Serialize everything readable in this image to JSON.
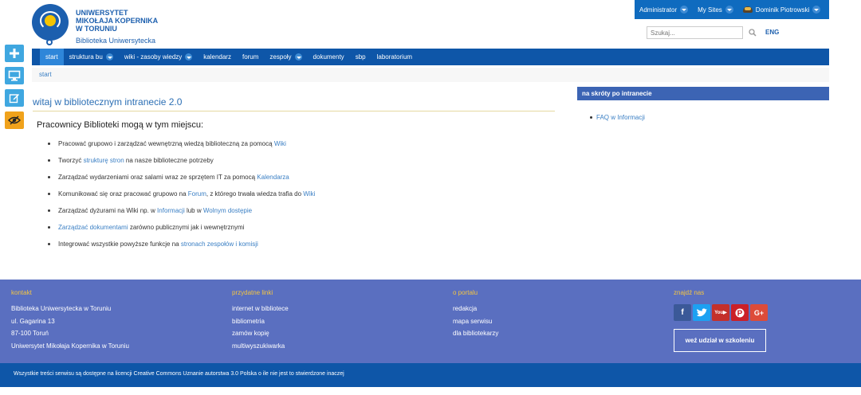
{
  "header": {
    "university": "UNIWERSYTET\nMIKOŁAJA KOPERNIKA\nW TORUNIU",
    "library": "Biblioteka Uniwersytecka",
    "user_menu": [
      "Administrator",
      "My Sites",
      "Dominik Piotrowski"
    ],
    "search_placeholder": "Szukaj...",
    "lang": "ENG"
  },
  "nav": {
    "items": [
      {
        "label": "start",
        "dropdown": false
      },
      {
        "label": "struktura bu",
        "dropdown": true
      },
      {
        "label": "wiki - zasoby wiedzy",
        "dropdown": true
      },
      {
        "label": "kalendarz",
        "dropdown": false
      },
      {
        "label": "forum",
        "dropdown": false
      },
      {
        "label": "zespoły",
        "dropdown": true
      },
      {
        "label": "dokumenty",
        "dropdown": false
      },
      {
        "label": "sbp",
        "dropdown": false
      },
      {
        "label": "laboratorium",
        "dropdown": false
      }
    ]
  },
  "breadcrumb": "start",
  "main": {
    "title": "witaj w bibliotecznym intranecie 2.0",
    "intro": "Pracownicy Biblioteki mogą w tym miejscu:",
    "items": [
      [
        {
          "t": "Pracować grupowo i zarządzać wewnętrzną wiedzą biblioteczną za pomocą "
        },
        {
          "t": "Wiki",
          "link": true
        }
      ],
      [
        {
          "t": "Tworzyć "
        },
        {
          "t": "strukturę stron",
          "link": true
        },
        {
          "t": " na nasze biblioteczne potrzeby"
        }
      ],
      [
        {
          "t": "Zarządzać wydarzeniami oraz salami wraz ze sprzętem IT za pomocą "
        },
        {
          "t": "Kalendarza",
          "link": true
        }
      ],
      [
        {
          "t": "Komunikować się oraz pracować grupowo na "
        },
        {
          "t": "Forum",
          "link": true
        },
        {
          "t": ", z którego trwała wiedza trafia do "
        },
        {
          "t": "Wiki",
          "link": true
        }
      ],
      [
        {
          "t": "Zarządzać dyżurami na Wiki np. w "
        },
        {
          "t": "Informacji",
          "link": true
        },
        {
          "t": " lub w "
        },
        {
          "t": "Wolnym dostępie",
          "link": true
        }
      ],
      [
        {
          "t": "Zarządzać dokumentami",
          "link": true
        },
        {
          "t": " zarówno publicznymi jak i wewnętrznymi"
        }
      ],
      [
        {
          "t": "Integrować wszystkie powyższe funkcje na "
        },
        {
          "t": "stronach zespołów i komisji",
          "link": true
        }
      ]
    ]
  },
  "sidebar": {
    "heading": "na skróty po intranecie",
    "links": [
      "FAQ w Informacji"
    ]
  },
  "footer": {
    "kontakt": {
      "heading": "kontakt",
      "lines": [
        "Biblioteka Uniwersytecka w Toruniu",
        "ul. Gagarina 13",
        "87-100 Toruń",
        "Uniwersytet Mikołaja Kopernika w Toruniu"
      ]
    },
    "links": {
      "heading": "przydatne linki",
      "items": [
        "internet w bibliotece",
        "bibliometria",
        "zamów kopię",
        "multiwyszukiwarka"
      ]
    },
    "about": {
      "heading": "o portalu",
      "items": [
        "redakcja",
        "mapa serwisu",
        "dla bibliotekarzy"
      ]
    },
    "social": {
      "heading": "znajdź nas",
      "icons": [
        "facebook-icon",
        "twitter-icon",
        "youtube-icon",
        "pinterest-icon",
        "google-plus-icon"
      ],
      "training_button": "weź udział w szkoleniu"
    },
    "license": "Wszystkie treści serwisu są dostępne na licencji Creative Commons Uznanie autorstwa 3.0 Polska o ile nie jest to stwierdzone inaczej"
  },
  "colors": {
    "brand_blue": "#0e56a8",
    "footer_bg": "#5a6fc0",
    "footer_heading": "#f4c542",
    "link": "#3a7fc4"
  }
}
